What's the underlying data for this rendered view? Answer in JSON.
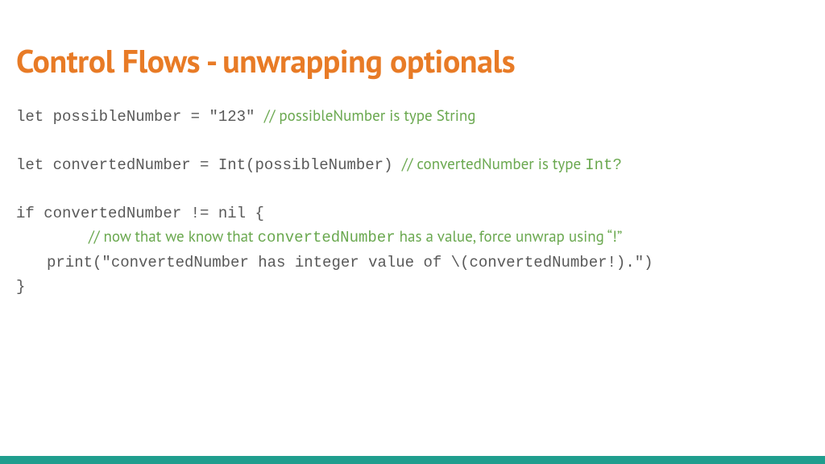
{
  "title": "Control Flows - unwrapping optionals",
  "code": {
    "l1_code": "let possibleNumber = \"123\"  ",
    "l1_comment": "// possibleNumber is type String",
    "l2_code": "let convertedNumber = Int(possibleNumber)  ",
    "l2_comment_a": "// convertedNumber is type ",
    "l2_comment_b": "Int?",
    "l3_code": "if convertedNumber != nil {",
    "l4_comment_a": "// now that we know that ",
    "l4_mono": "convertedNumber",
    "l4_comment_b": " has a value, force unwrap using ",
    "l4_quote": "“!”",
    "l5_code": "print(\"convertedNumber has integer value of \\(convertedNumber!).\")",
    "l6_code": "}"
  },
  "colors": {
    "accent": "#e87b26",
    "footer": "#1f9e8e",
    "code": "#595959",
    "comment": "#6aa84f"
  }
}
